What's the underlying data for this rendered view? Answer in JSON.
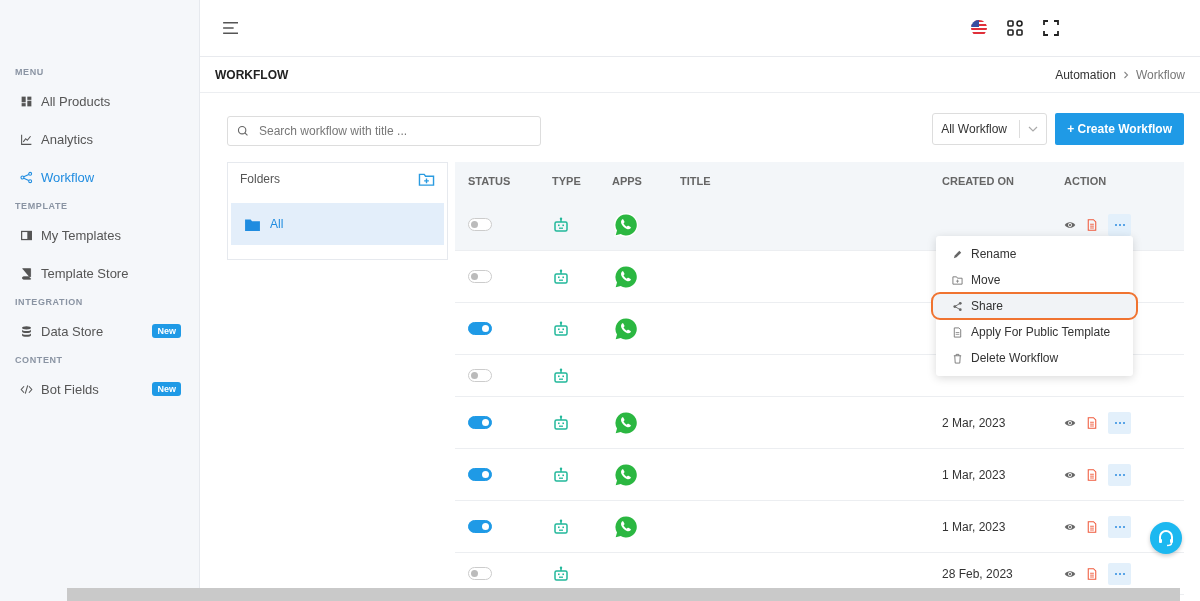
{
  "sidebar": {
    "sections": [
      {
        "heading": "MENU",
        "items": [
          {
            "label": "All Products",
            "selected": false
          },
          {
            "label": "Analytics",
            "selected": false
          },
          {
            "label": "Workflow",
            "selected": true
          }
        ]
      },
      {
        "heading": "TEMPLATE",
        "items": [
          {
            "label": "My Templates",
            "selected": false
          },
          {
            "label": "Template Store",
            "selected": false
          }
        ]
      },
      {
        "heading": "INTEGRATION",
        "items": [
          {
            "label": "Data Store",
            "selected": false,
            "badge": "New"
          }
        ]
      },
      {
        "heading": "CONTENT",
        "items": [
          {
            "label": "Bot Fields",
            "selected": false,
            "badge": "New"
          }
        ]
      }
    ]
  },
  "page_title": "WORKFLOW",
  "breadcrumb": [
    "Automation",
    "Workflow"
  ],
  "search": {
    "placeholder": "Search workflow with title ..."
  },
  "filter": {
    "value": "All Workflow"
  },
  "create_button": "+ Create Workflow",
  "folders": {
    "title": "Folders",
    "items": [
      {
        "label": "All",
        "selected": true
      }
    ]
  },
  "table": {
    "columns": [
      "STATUS",
      "TYPE",
      "APPS",
      "TITLE",
      "CREATED ON",
      "ACTION"
    ],
    "rows": [
      {
        "on": false,
        "whatsapp": true,
        "actions_visible": true,
        "selected": true
      },
      {
        "on": false,
        "whatsapp": true,
        "actions_visible": false,
        "selected": false
      },
      {
        "on": true,
        "whatsapp": true,
        "actions_visible": false,
        "selected": false
      },
      {
        "on": false,
        "whatsapp": false,
        "actions_visible": false,
        "selected": false
      },
      {
        "on": true,
        "whatsapp": true,
        "created": "2 Mar, 2023",
        "actions_visible": true,
        "selected": false
      },
      {
        "on": true,
        "whatsapp": true,
        "created": "1 Mar, 2023",
        "actions_visible": true,
        "selected": false
      },
      {
        "on": true,
        "whatsapp": true,
        "created": "1 Mar, 2023",
        "actions_visible": true,
        "selected": false
      },
      {
        "on": false,
        "whatsapp": false,
        "created": "28 Feb, 2023",
        "actions_visible": true,
        "selected": false
      }
    ]
  },
  "context_menu": {
    "items": [
      {
        "label": "Rename",
        "selected": false
      },
      {
        "label": "Move",
        "selected": false
      },
      {
        "label": "Share",
        "selected": true
      },
      {
        "label": "Apply For Public Template",
        "selected": false
      },
      {
        "label": "Delete Workflow",
        "selected": false
      }
    ]
  }
}
